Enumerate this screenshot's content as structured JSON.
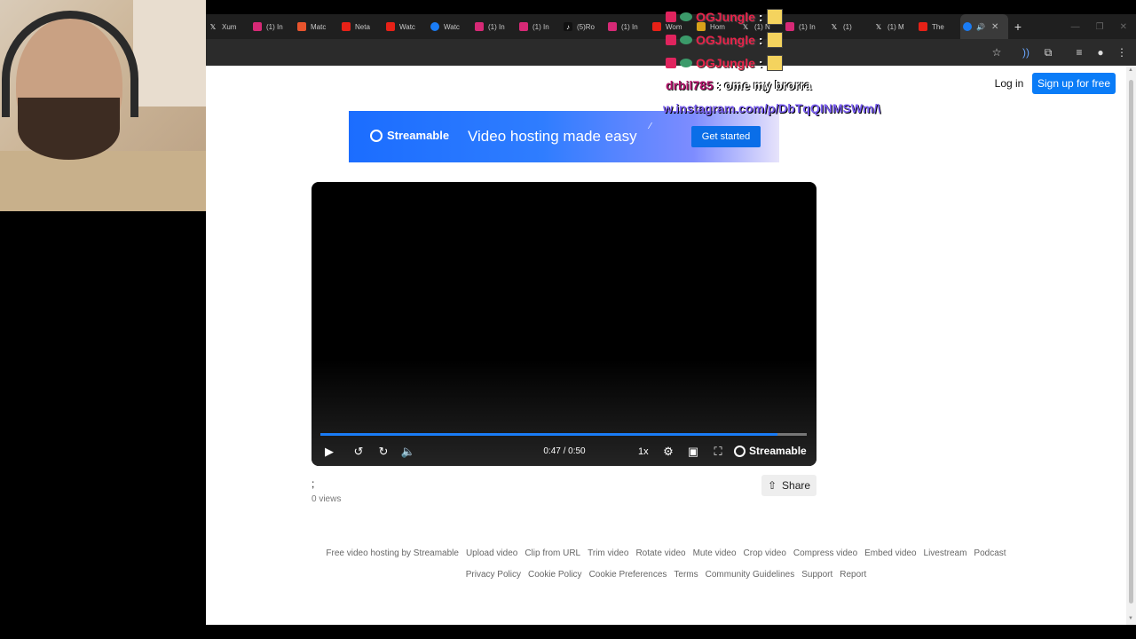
{
  "browser": {
    "tabs": [
      {
        "favicon": "x-icon",
        "label": "Xum"
      },
      {
        "favicon": "instagram-icon",
        "label": "(1) In"
      },
      {
        "favicon": "match-icon",
        "label": "Matc"
      },
      {
        "favicon": "youtube-icon",
        "label": "Neta"
      },
      {
        "favicon": "youtube-icon",
        "label": "Watc"
      },
      {
        "favicon": "streamable-icon",
        "label": "Watc"
      },
      {
        "favicon": "instagram-icon",
        "label": "(1) In"
      },
      {
        "favicon": "instagram-icon",
        "label": "(1) In"
      },
      {
        "favicon": "tiktok-icon",
        "label": "(5)Ro"
      },
      {
        "favicon": "instagram-icon",
        "label": "(1) In"
      },
      {
        "favicon": "youtube-icon",
        "label": "Wom"
      },
      {
        "favicon": "trophy-icon",
        "label": "Hom"
      },
      {
        "favicon": "x-icon",
        "label": "(1) N"
      },
      {
        "favicon": "instagram-icon",
        "label": "(1) In"
      },
      {
        "favicon": "x-icon",
        "label": "(1)"
      },
      {
        "favicon": "x-icon",
        "label": "(1) M"
      },
      {
        "favicon": "youtube-icon",
        "label": "The"
      }
    ],
    "active_tab_favicon": "streamable-icon",
    "new_tab": "+"
  },
  "header": {
    "login": "Log in",
    "signup": "Sign up for free"
  },
  "banner": {
    "brand": "Streamable",
    "tagline": "Video hosting made easy",
    "cta": "Get started"
  },
  "player": {
    "time": "0:47 / 0:50",
    "progress": 0.94,
    "speed": "1x",
    "brand": "Streamable"
  },
  "video": {
    "title": ";",
    "views": "0 views",
    "share": "Share"
  },
  "footer": {
    "row1": [
      "Free video hosting by Streamable",
      "Upload video",
      "Clip from URL",
      "Trim video",
      "Rotate video",
      "Mute video",
      "Crop video",
      "Compress video",
      "Embed video",
      "Livestream",
      "Podcast"
    ],
    "row2": [
      "Privacy Policy",
      "Cookie Policy",
      "Cookie Preferences",
      "Terms",
      "Community Guidelines",
      "Support",
      "Report"
    ]
  },
  "chat": {
    "lines": [
      {
        "user": "OGJungle",
        "sep": ":"
      },
      {
        "user": "OGJungle",
        "sep": ":"
      },
      {
        "user": "OGJungle",
        "sep": ":"
      }
    ],
    "message_user": "drbil785",
    "message_text": ": ome my brorra",
    "url_text": "w.instagram.com/p/DbTqQINMSWm/\\"
  },
  "colors": {
    "accent": "#0a7cf7",
    "chrome_dark": "#1f1f1f",
    "chat_user": "#e8234a"
  }
}
